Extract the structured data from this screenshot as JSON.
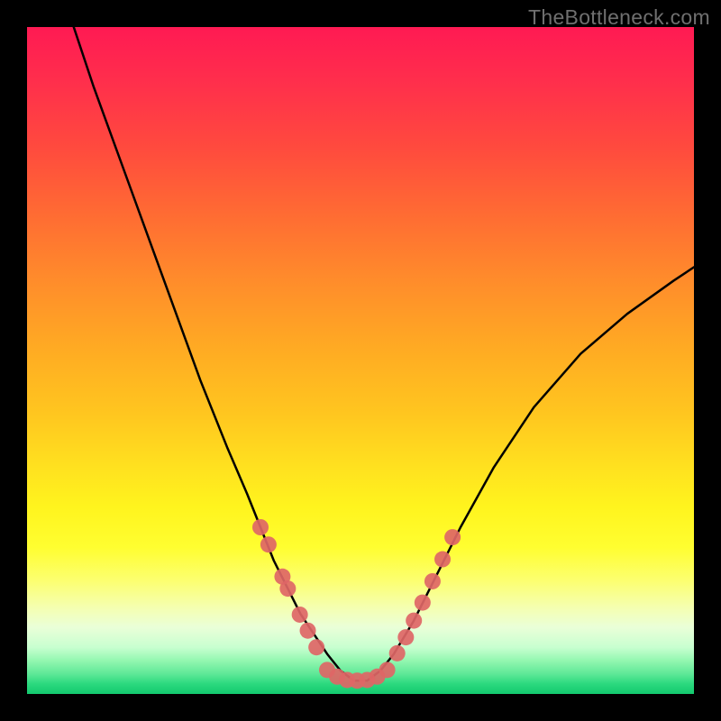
{
  "watermark": "TheBottleneck.com",
  "chart_data": {
    "type": "line",
    "title": "",
    "xlabel": "",
    "ylabel": "",
    "xlim": [
      0,
      100
    ],
    "ylim": [
      0,
      100
    ],
    "grid": false,
    "series": [
      {
        "name": "bottleneck-curve",
        "color": "#000000",
        "x": [
          7,
          10,
          14,
          18,
          22,
          26,
          30,
          33,
          35,
          37,
          39,
          41,
          43,
          45,
          47,
          49,
          51,
          53,
          55,
          58,
          61,
          65,
          70,
          76,
          83,
          90,
          97,
          100
        ],
        "y": [
          100,
          91,
          80,
          69,
          58,
          47,
          37,
          30,
          25,
          20,
          16,
          12,
          9,
          6,
          3.5,
          2,
          2,
          3.5,
          6,
          11,
          17,
          25,
          34,
          43,
          51,
          57,
          62,
          64
        ]
      }
    ],
    "markers": [
      {
        "name": "left-cluster",
        "color": "#de6666",
        "points_x": [
          35.0,
          36.2,
          38.3,
          39.1,
          40.9,
          42.1,
          43.4
        ],
        "points_y": [
          25.0,
          22.4,
          17.6,
          15.8,
          11.9,
          9.5,
          7.0
        ]
      },
      {
        "name": "floor-cluster",
        "color": "#de6666",
        "points_x": [
          45.0,
          46.5,
          48.0,
          49.5,
          51.0,
          52.5,
          54.0
        ],
        "points_y": [
          3.6,
          2.6,
          2.1,
          2.0,
          2.1,
          2.6,
          3.6
        ]
      },
      {
        "name": "right-cluster",
        "color": "#de6666",
        "points_x": [
          55.5,
          56.8,
          58.0,
          59.3,
          60.8,
          62.3,
          63.8
        ],
        "points_y": [
          6.1,
          8.5,
          11.0,
          13.7,
          16.9,
          20.2,
          23.5
        ]
      }
    ],
    "bands": [
      {
        "name": "pale-yellow-band",
        "y0": 78,
        "y1": 87,
        "color": "#fbffd2"
      },
      {
        "name": "green-band",
        "y0": 95,
        "y1": 100,
        "color": "#2bd97e"
      }
    ]
  }
}
